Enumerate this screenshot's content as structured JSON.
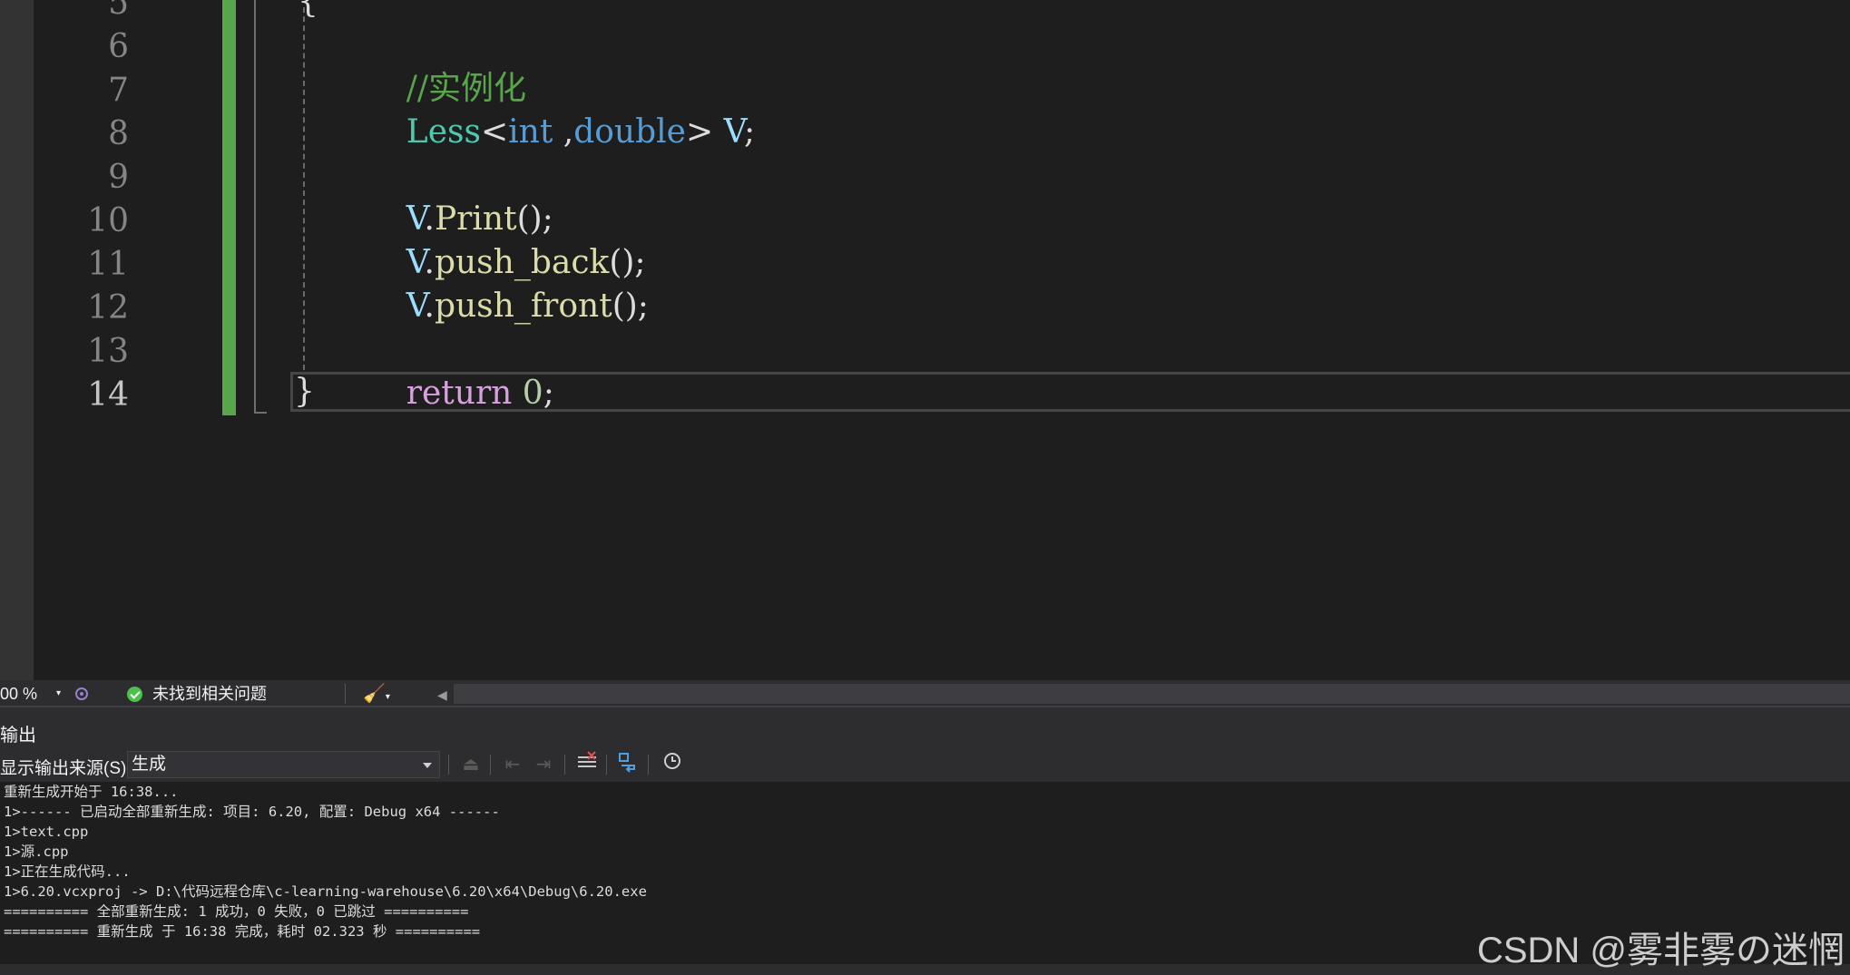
{
  "editor": {
    "line_numbers": [
      "5",
      "6",
      "7",
      "8",
      "9",
      "10",
      "11",
      "12",
      "13",
      "14"
    ],
    "top_partial": "{",
    "lines": {
      "l6_comment": "//实例化",
      "l7_type": "Less",
      "l7_lt": "<",
      "l7_t1": "int",
      "l7_comma": " ,",
      "l7_t2": "double",
      "l7_gt": "> ",
      "l7_var": "V",
      "l7_semi": ";",
      "l9_var": "V",
      "l9_dot": ".",
      "l9_fn": "Print",
      "l9_rest": "();",
      "l10_var": "V",
      "l10_dot": ".",
      "l10_fn": "push_back",
      "l10_rest": "();",
      "l11_var": "V",
      "l11_dot": ".",
      "l11_fn": "push_front",
      "l11_rest": "();",
      "l13_kw": "return",
      "l13_num": "0",
      "l13_semi": ";",
      "l14_brace": "}"
    },
    "colors": {
      "comment": "#57a64a",
      "type": "#4ec9b0",
      "keyword": "#569cd6",
      "identifier": "#9cdcfe",
      "function": "#dcdcaa",
      "control": "#d8a0df",
      "number": "#b5cea8",
      "change_bar": "#57a64a"
    }
  },
  "status_bar": {
    "zoom": "00 %",
    "issues": "未找到相关问题"
  },
  "output_panel": {
    "title": "输出",
    "source_label": "显示输出来源(S):",
    "source_value": "生成",
    "lines": [
      "重新生成开始于 16:38...",
      "1>------ 已启动全部重新生成: 项目: 6.20, 配置: Debug x64 ------",
      "1>text.cpp",
      "1>源.cpp",
      "1>正在生成代码...",
      "1>6.20.vcxproj -> D:\\代码远程仓库\\c-learning-warehouse\\6.20\\x64\\Debug\\6.20.exe",
      "========== 全部重新生成: 1 成功，0 失败，0 已跳过 ==========",
      "========== 重新生成 于 16:38 完成，耗时 02.323 秒 =========="
    ]
  },
  "watermark": "CSDN @雾非雾の迷惘"
}
